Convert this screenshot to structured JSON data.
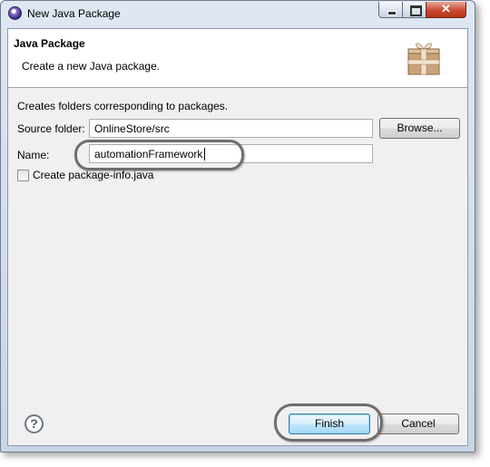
{
  "window": {
    "title": "New Java Package",
    "controls": {
      "close_glyph": "✕"
    }
  },
  "banner": {
    "title": "Java Package",
    "message": "Create a new Java package.",
    "icon": "package-icon"
  },
  "form": {
    "description": "Creates folders corresponding to packages.",
    "source_folder": {
      "label": "Source folder:",
      "value": "OnlineStore/src",
      "browse_label": "Browse..."
    },
    "name": {
      "label": "Name:",
      "value": "automationFramework"
    },
    "create_package_info": {
      "label": "Create package-info.java",
      "checked": false
    }
  },
  "footer": {
    "help_glyph": "?",
    "finish_label": "Finish",
    "cancel_label": "Cancel"
  }
}
